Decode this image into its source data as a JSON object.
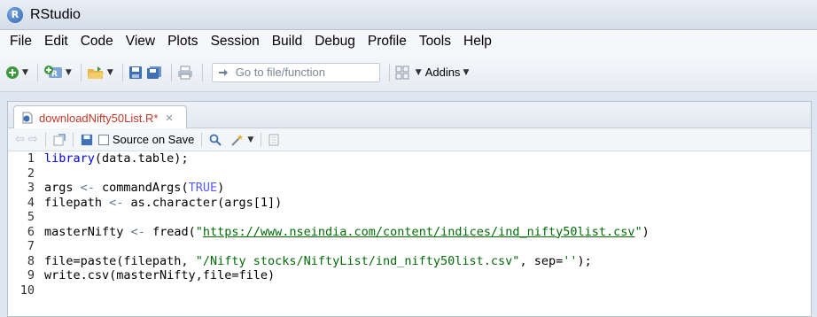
{
  "window": {
    "title": "RStudio",
    "app_icon_letter": "R"
  },
  "menu": [
    "File",
    "Edit",
    "Code",
    "View",
    "Plots",
    "Session",
    "Build",
    "Debug",
    "Profile",
    "Tools",
    "Help"
  ],
  "toolbar": {
    "goto_placeholder": "Go to file/function",
    "addins_label": "Addins"
  },
  "editor": {
    "tab_label": "downloadNifty50List.R*",
    "source_on_save_label": "Source on Save",
    "lines": [
      {
        "n": "1",
        "code": "library(data.table);"
      },
      {
        "n": "2",
        "code": ""
      },
      {
        "n": "3",
        "code": "args <- commandArgs(TRUE)"
      },
      {
        "n": "4",
        "code": "filepath <- as.character(args[1])"
      },
      {
        "n": "5",
        "code": ""
      },
      {
        "n": "6",
        "code": "masterNifty <- fread(\"https://www.nseindia.com/content/indices/ind_nifty50list.csv\")"
      },
      {
        "n": "7",
        "code": ""
      },
      {
        "n": "8",
        "code": "file=paste(filepath, \"/Nifty stocks/NiftyList/ind_nifty50list.csv\", sep='');"
      },
      {
        "n": "9",
        "code": "write.csv(masterNifty,file=file)"
      },
      {
        "n": "10",
        "code": ""
      }
    ]
  },
  "colors": {
    "keyword": "#0000ff",
    "string": "#036a07",
    "constant": "#585cf6",
    "modified_tab": "#c0392b"
  }
}
